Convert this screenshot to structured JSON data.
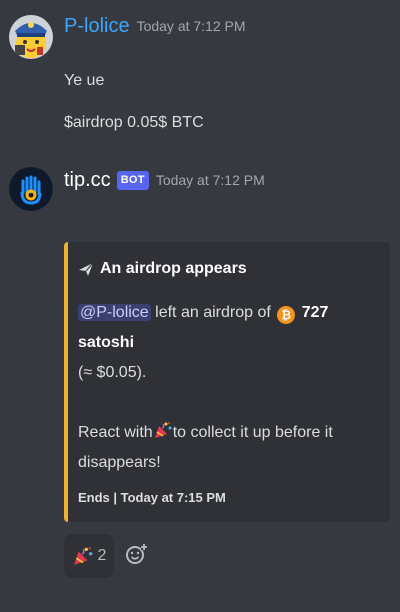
{
  "messages": [
    {
      "username": "P-lolice",
      "timestamp": "Today at 7:12 PM",
      "lines": [
        "Ye ue",
        "$airdrop 0.05$ BTC"
      ]
    },
    {
      "username": "tip.cc",
      "bot_tag": "BOT",
      "timestamp": "Today at 7:12 PM",
      "embed": {
        "accent_color": "#f0b232",
        "title": "An airdrop appears",
        "title_icon": "airplane-icon",
        "mention": "@P-lolice",
        "text_left": "left an airdrop of",
        "currency_icon": "bitcoin-icon",
        "currency_symbol": "₿",
        "amount": "727 satoshi",
        "approx": "(≈ $0.05).",
        "react_prefix": "React with",
        "react_icon": "party-popper-icon",
        "react_suffix": "to collect it up before it",
        "react_suffix2": "disappears!",
        "footer": "Ends | Today at 7:15 PM"
      },
      "reactions": [
        {
          "icon": "party-popper-icon",
          "count": "2"
        }
      ]
    }
  ],
  "colors": {
    "background": "#36393f",
    "embed_background": "#2f3136",
    "username_user": "#3aa7ff",
    "bot_tag": "#5865f2"
  }
}
